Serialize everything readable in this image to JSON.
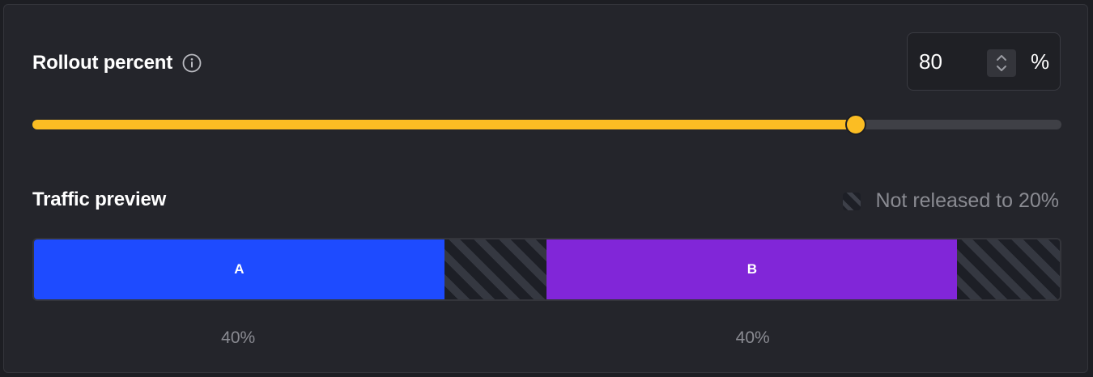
{
  "rollout": {
    "label": "Rollout percent",
    "info_icon": "info-icon",
    "value": "80",
    "unit": "%",
    "slider_value_percent": 80,
    "accent_color": "#fbbd23"
  },
  "traffic": {
    "title": "Traffic preview",
    "legend_label": "Not released to 20%",
    "legend_icon": "striped-swatch-icon",
    "segments": [
      {
        "label": "A",
        "released": true,
        "share_percent": 40,
        "color": "#1e4bff"
      },
      {
        "label": "",
        "released": false,
        "share_percent": 10
      },
      {
        "label": "B",
        "released": true,
        "share_percent": 40,
        "color": "#8126d8"
      },
      {
        "label": "",
        "released": false,
        "share_percent": 10
      }
    ],
    "variant_percents": [
      {
        "variant": "A",
        "text": "40%"
      },
      {
        "variant": "B",
        "text": "40%"
      }
    ]
  }
}
